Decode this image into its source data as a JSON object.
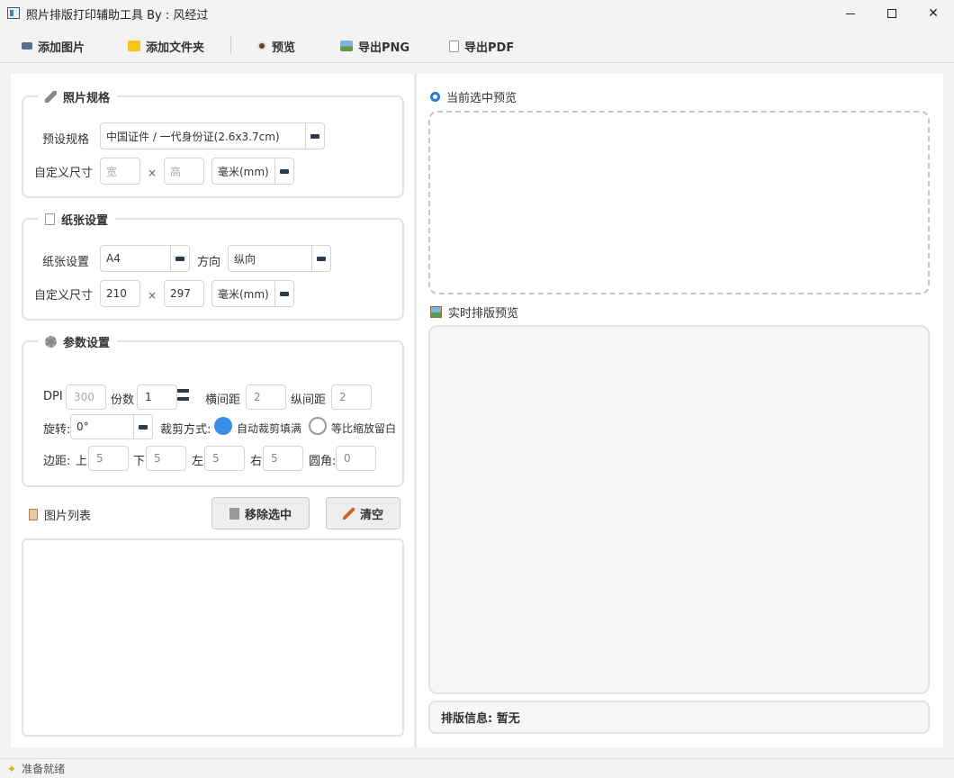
{
  "window": {
    "title": "照片排版打印辅助工具 By : 风经过"
  },
  "toolbar": {
    "add_image": "添加图片",
    "add_folder": "添加文件夹",
    "preview": "预览",
    "export_png": "导出PNG",
    "export_pdf": "导出PDF"
  },
  "photo_spec": {
    "title": "照片规格",
    "preset_label": "预设规格",
    "preset_value": "中国证件 / 一代身份证(2.6x3.7cm)",
    "custom_label": "自定义尺寸",
    "width_placeholder": "宽",
    "height_placeholder": "高",
    "times": "×",
    "unit": "毫米(mm)"
  },
  "paper": {
    "title": "纸张设置",
    "paper_label": "纸张设置",
    "paper_value": "A4",
    "orientation_label": "方向",
    "orientation_value": "纵向",
    "custom_label": "自定义尺寸",
    "width": "210",
    "height": "297",
    "times": "×",
    "unit": "毫米(mm)"
  },
  "params": {
    "title": "参数设置",
    "dpi_label": "DPI",
    "dpi": "300",
    "copies_label": "份数",
    "copies": "1",
    "h_gap_label": "横间距",
    "h_gap": "2",
    "v_gap_label": "纵间距",
    "v_gap": "2",
    "rotate_label": "旋转:",
    "rotate_value": "0°",
    "crop_label": "裁剪方式:",
    "crop_auto": "自动裁剪填满",
    "crop_fit": "等比缩放留白",
    "margin_label": "边距:",
    "top_label": "上",
    "top": "5",
    "bottom_label": "下",
    "bottom": "5",
    "left_label": "左",
    "left": "5",
    "right_label": "右",
    "right": "5",
    "radius_label": "圆角:",
    "radius": "0"
  },
  "image_list": {
    "title": "图片列表",
    "remove_selected": "移除选中",
    "clear": "清空"
  },
  "right": {
    "current_preview": "当前选中预览",
    "live_preview": "实时排版预览",
    "info": "排版信息:  暂无"
  },
  "status": {
    "text": "准备就绪"
  }
}
